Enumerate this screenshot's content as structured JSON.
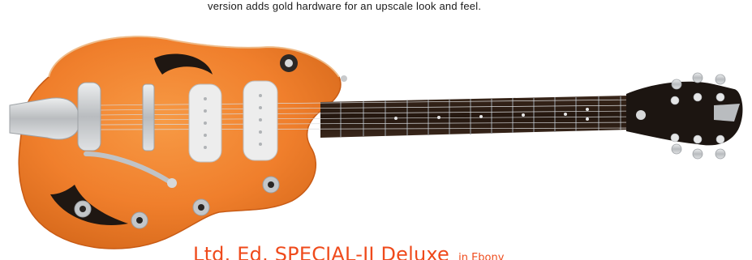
{
  "description": {
    "text": "version adds gold hardware for an upscale look and feel."
  },
  "product": {
    "name": "Ltd. Ed. SPECIAL-II Deluxe",
    "finish": "in Ebony"
  },
  "colors": {
    "body": "#f07f2c",
    "body_dark": "#d5621a",
    "neck": "#2b1c14",
    "chrome": "#c9cbcd",
    "title": "#ef4a1b"
  },
  "image": {
    "name": "orange-hollow-body-guitar"
  }
}
